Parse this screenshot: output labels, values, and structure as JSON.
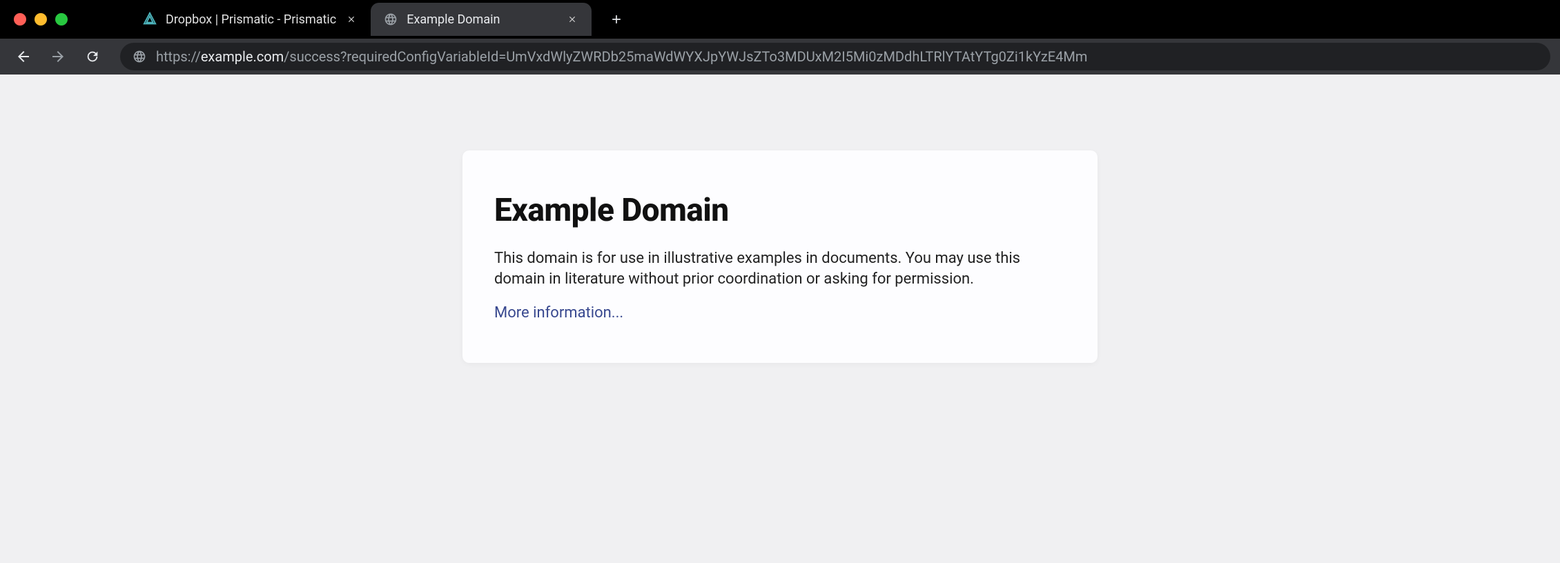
{
  "tabs": [
    {
      "title": "Dropbox | Prismatic - Prismatic",
      "active": false
    },
    {
      "title": "Example Domain",
      "active": true
    }
  ],
  "url": {
    "protocol": "https://",
    "domain": "example.com",
    "path": "/success?requiredConfigVariableId=UmVxdWlyZWRDb25maWdWYXJpYWJsZTo3MDUxM2I5Mi0zMDdhLTRlYTAtYTg0Zi1kYzE4Mm"
  },
  "page": {
    "heading": "Example Domain",
    "body": "This domain is for use in illustrative examples in documents. You may use this domain in literature without prior coordination or asking for permission.",
    "link_text": "More information..."
  }
}
